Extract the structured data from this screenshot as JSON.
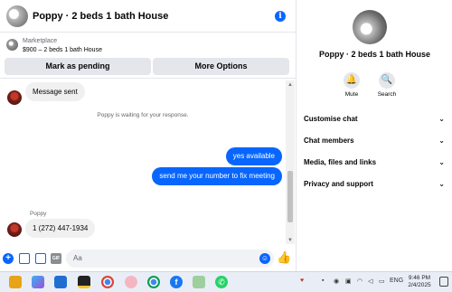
{
  "header": {
    "title": "Poppy · 2 beds 1 bath House",
    "info_icon": "info-icon"
  },
  "marketplace": {
    "label": "Marketplace",
    "listing": "$900 – 2 beds 1 bath House",
    "mark_pending_label": "Mark as pending",
    "more_options_label": "More Options"
  },
  "messages": {
    "first_incoming": "Message sent",
    "waiting_notice": "Poppy is waiting for your response.",
    "outgoing_1": "yes available",
    "outgoing_2": "send me your number to fix meeting",
    "sender_name": "Poppy",
    "phone_message": "1 (272) 447-1934"
  },
  "composer": {
    "placeholder": "Aa"
  },
  "profile": {
    "name": "Poppy · 2 beds 1 bath House",
    "mute_label": "Mute",
    "search_label": "Search",
    "sections": [
      "Customise chat",
      "Chat members",
      "Media, files and links",
      "Privacy and support"
    ]
  },
  "taskbar": {
    "language": "ENG",
    "time": "9:46 PM",
    "date": "2/4/2025"
  },
  "colors": {
    "accent": "#0866ff",
    "bubble_in": "#f0f0f0",
    "divider": "#e4e6eb"
  }
}
